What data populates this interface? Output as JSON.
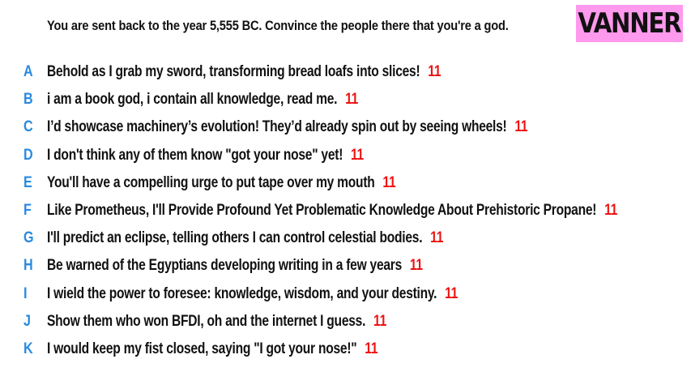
{
  "prompt": "You are sent back to the year 5,555 BC. Convince the people there that you're a god.",
  "badge": {
    "label": "VANNER",
    "color": "#ff99ee"
  },
  "colors": {
    "letter": "#2a8adf",
    "text": "#111111",
    "score": "#ee1111"
  },
  "entries": [
    {
      "letter": "A",
      "text": "Behold as I grab my sword, transforming bread loafs into slices!",
      "score": "11"
    },
    {
      "letter": "B",
      "text": "i am a book god, i contain all knowledge, read me.",
      "score": "11"
    },
    {
      "letter": "C",
      "text": "I’d showcase machinery’s evolution! They’d already spin out by seeing wheels!",
      "score": "11"
    },
    {
      "letter": "D",
      "text": "I don't think any of them know \"got your nose\" yet!",
      "score": "11"
    },
    {
      "letter": "E",
      "text": "You'll have a compelling urge to put tape over my mouth",
      "score": "11"
    },
    {
      "letter": "F",
      "text": "Like Prometheus, I'll Provide Profound Yet Problematic Knowledge About Prehistoric Propane!",
      "score": "11"
    },
    {
      "letter": "G",
      "text": "I'll predict an eclipse, telling others I can control celestial bodies.",
      "score": "11"
    },
    {
      "letter": "H",
      "text": "Be warned of the Egyptians developing writing in a few years",
      "score": "11"
    },
    {
      "letter": "I",
      "text": "I wield the power to foresee: knowledge, wisdom, and your destiny.",
      "score": "11"
    },
    {
      "letter": "J",
      "text": "Show them who won BFDI, oh and the internet I guess.",
      "score": "11"
    },
    {
      "letter": "K",
      "text": "I would keep my fist closed, saying \"I got your nose!\"",
      "score": "11"
    }
  ]
}
